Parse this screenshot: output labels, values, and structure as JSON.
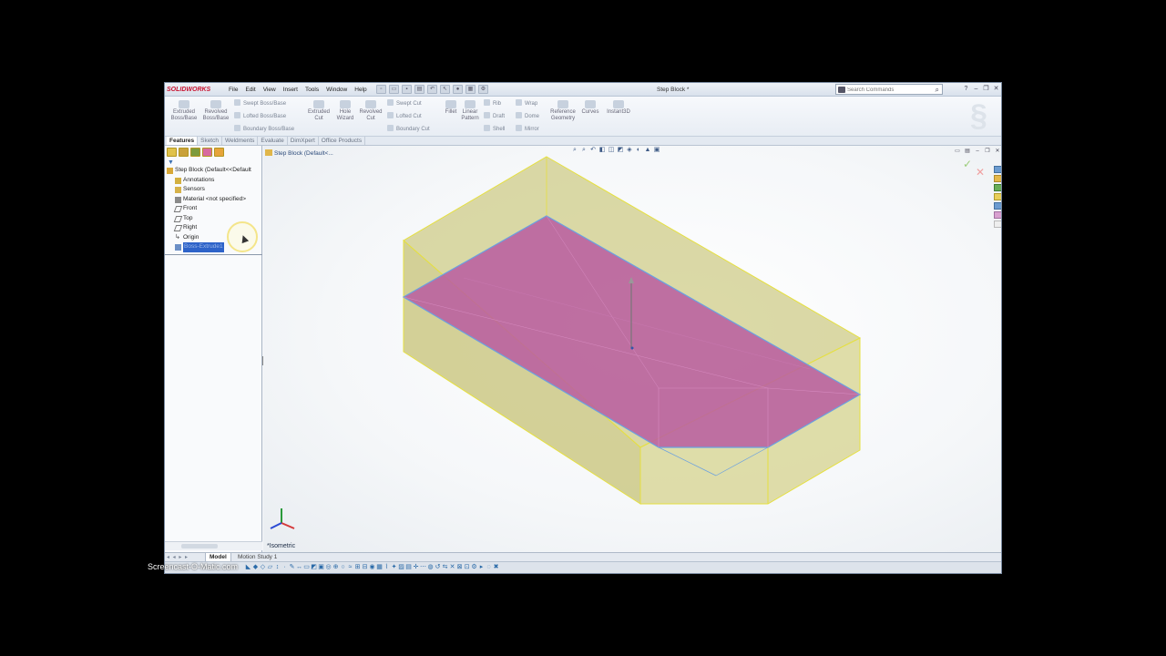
{
  "app": {
    "logo_text": "SOLIDWORKS",
    "document_title": "Step Block *",
    "menu": [
      "File",
      "Edit",
      "View",
      "Insert",
      "Tools",
      "Window",
      "Help"
    ],
    "search_placeholder": "Search Commands"
  },
  "command_manager": {
    "extruded_boss": "Extruded\nBoss/Base",
    "revolved_boss": "Revolved\nBoss/Base",
    "swept_boss": "Swept Boss/Base",
    "lofted_boss": "Lofted Boss/Base",
    "boundary_boss": "Boundary Boss/Base",
    "extruded_cut": "Extruded\nCut",
    "hole_wizard": "Hole\nWizard",
    "revolved_cut": "Revolved\nCut",
    "swept_cut": "Swept Cut",
    "lofted_cut": "Lofted Cut",
    "boundary_cut": "Boundary Cut",
    "fillet": "Fillet",
    "linear_pattern": "Linear\nPattern",
    "rib": "Rib",
    "draft": "Draft",
    "shell": "Shell",
    "wrap": "Wrap",
    "dome": "Dome",
    "mirror": "Mirror",
    "reference_geometry": "Reference\nGeometry",
    "curves": "Curves",
    "instant3d": "Instant3D"
  },
  "cmd_tabs": [
    "Features",
    "Sketch",
    "Weldments",
    "Evaluate",
    "DimXpert",
    "Office Products"
  ],
  "tree": {
    "root": "Step Block  (Default<<Default",
    "items": [
      "Annotations",
      "Sensors",
      "Material <not specified>",
      "Front",
      "Top",
      "Right",
      "Origin",
      "Boss-Extrude1"
    ]
  },
  "viewport": {
    "breadcrumb": "Step Block  (Default<...",
    "view_label": "*Isometric"
  },
  "bottom_tabs": [
    "Model",
    "Motion Study 1"
  ],
  "overlay_watermark": "Screencast-O-Matic.com",
  "colors": {
    "solid_face": "#d4d28c",
    "sketch_face": "#b85ca0",
    "edge_highlight": "#6aa0e0",
    "edge_yellow": "#e6e040"
  }
}
